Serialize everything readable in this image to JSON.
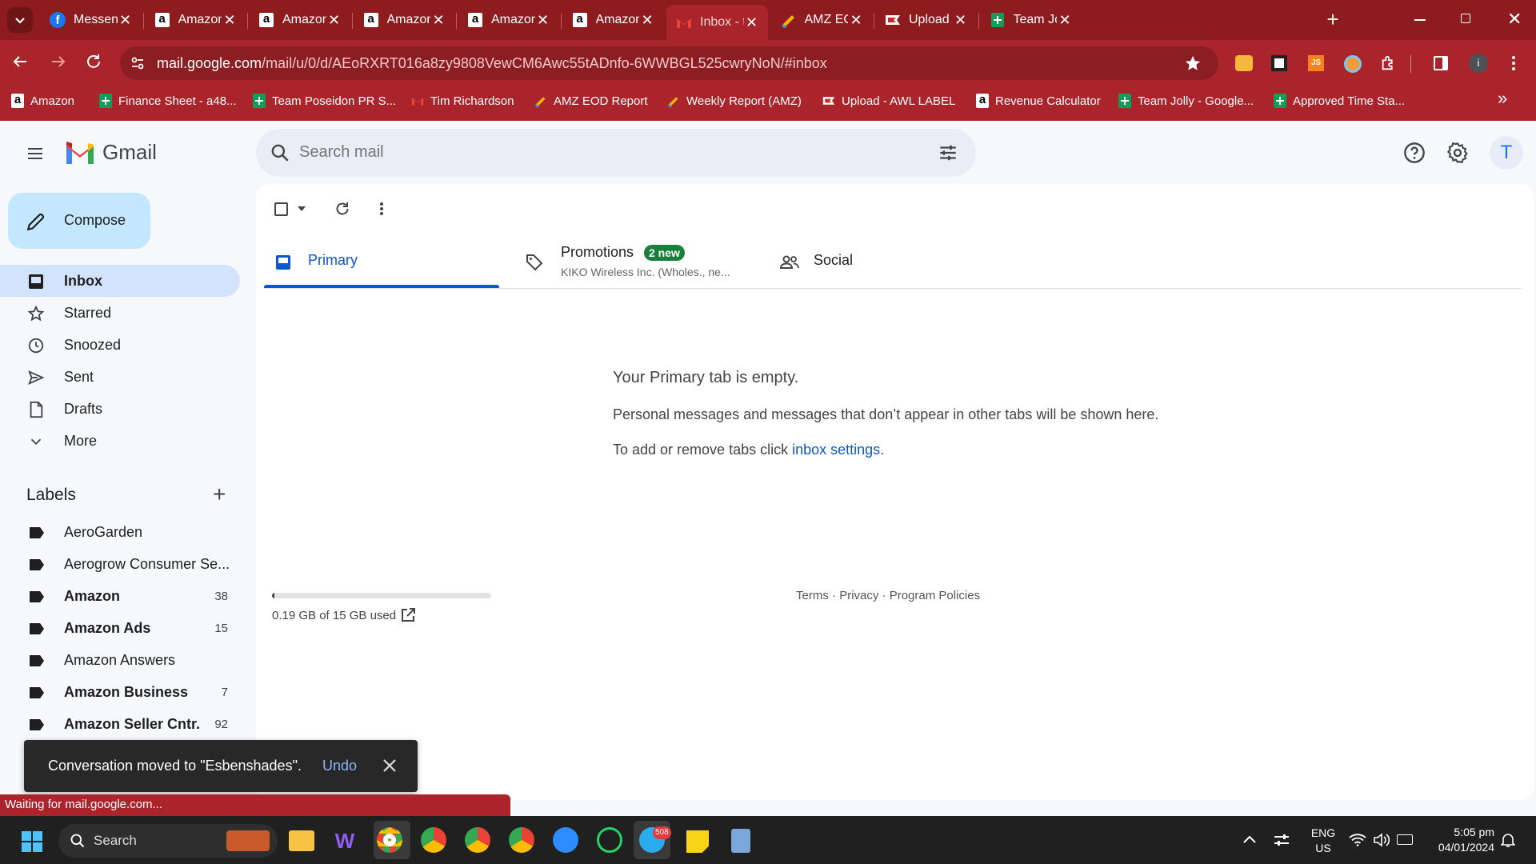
{
  "browser": {
    "tabs": [
      {
        "title": "Messenger",
        "favicon": "facebook-icon",
        "color": "#1877f2"
      },
      {
        "title": "Amazon",
        "favicon": "amazon-icon",
        "color": "#000000"
      },
      {
        "title": "Amazon",
        "favicon": "amazon-icon",
        "color": "#000000"
      },
      {
        "title": "Amazon",
        "favicon": "amazon-icon",
        "color": "#000000"
      },
      {
        "title": "Amazon",
        "favicon": "amazon-icon",
        "color": "#000000"
      },
      {
        "title": "Amazon",
        "favicon": "amazon-icon",
        "color": "#000000"
      },
      {
        "title": "Inbox - tnc",
        "favicon": "gmail-icon",
        "color": "#ea4335",
        "active": true
      },
      {
        "title": "AMZ EOD",
        "favicon": "pencil-doc-icon",
        "color": "#f4b400"
      },
      {
        "title": "Upload - A",
        "favicon": "flag-icon",
        "color": "#c62828"
      },
      {
        "title": "Team Jolly",
        "favicon": "sheets-icon",
        "color": "#0f9d58"
      }
    ],
    "url_host": "mail.google.com",
    "url_path": "/mail/u/0/d/AEoRXRT016a8zy9808VewCM6Awc55tADnfo-6WWBGL525cwryNoN/#inbox",
    "bookmarks": [
      {
        "label": "Amazon",
        "icon": "amazon-icon"
      },
      {
        "label": "Finance Sheet - a48...",
        "icon": "sheets-icon"
      },
      {
        "label": "Team Poseidon PR S...",
        "icon": "sheets-icon"
      },
      {
        "label": "Tim Richardson",
        "icon": "gmail-icon"
      },
      {
        "label": "AMZ EOD Report",
        "icon": "pencil-doc-icon"
      },
      {
        "label": "Weekly Report (AMZ)",
        "icon": "pencil-doc-icon"
      },
      {
        "label": "Upload - AWL LABEL",
        "icon": "flag-icon"
      },
      {
        "label": "Revenue Calculator",
        "icon": "amazon-icon"
      },
      {
        "label": "Team Jolly - Google...",
        "icon": "sheets-icon"
      },
      {
        "label": "Approved Time Sta...",
        "icon": "sheets-icon"
      }
    ],
    "status_text": "Waiting for mail.google.com..."
  },
  "gmail": {
    "logo_text": "Gmail",
    "search_placeholder": "Search mail",
    "avatar_letter": "T",
    "compose_label": "Compose",
    "nav": [
      {
        "label": "Inbox",
        "icon": "inbox-icon",
        "selected": true
      },
      {
        "label": "Starred",
        "icon": "star-icon"
      },
      {
        "label": "Snoozed",
        "icon": "clock-icon"
      },
      {
        "label": "Sent",
        "icon": "send-icon"
      },
      {
        "label": "Drafts",
        "icon": "draft-icon"
      },
      {
        "label": "More",
        "icon": "chevron-down-icon"
      }
    ],
    "labels_heading": "Labels",
    "labels": [
      {
        "name": "AeroGarden",
        "count": "",
        "bold": false
      },
      {
        "name": "Aerogrow Consumer Se...",
        "count": "",
        "bold": false
      },
      {
        "name": "Amazon",
        "count": "38",
        "bold": true
      },
      {
        "name": "Amazon Ads",
        "count": "15",
        "bold": true
      },
      {
        "name": "Amazon Answers",
        "count": "",
        "bold": false
      },
      {
        "name": "Amazon Business",
        "count": "7",
        "bold": true
      },
      {
        "name": "Amazon Seller Cntr.",
        "count": "92",
        "bold": true
      }
    ],
    "inbox_tabs": {
      "primary": "Primary",
      "promotions": "Promotions",
      "promotions_badge": "2 new",
      "promotions_sub": "KIKO Wireless Inc. (Wholes., ne...",
      "social": "Social"
    },
    "empty": {
      "heading": "Your Primary tab is empty.",
      "line1": "Personal messages and messages that don’t appear in other tabs will be shown here.",
      "line2_prefix": "To add or remove tabs click ",
      "line2_link": "inbox settings",
      "line2_suffix": "."
    },
    "storage": {
      "text": "0.19 GB of 15 GB used",
      "used_fraction": 0.0127
    },
    "footer": {
      "terms": "Terms",
      "privacy": "Privacy",
      "policies": "Program Policies",
      "dot": "·"
    },
    "toast": {
      "message": "Conversation moved to \"Esbenshades\".",
      "action": "Undo"
    }
  },
  "taskbar": {
    "search_label": "Search",
    "lang_line1": "ENG",
    "lang_line2": "US",
    "time": "5:05 pm",
    "date": "04/01/2024",
    "telegram_badge": "508"
  }
}
